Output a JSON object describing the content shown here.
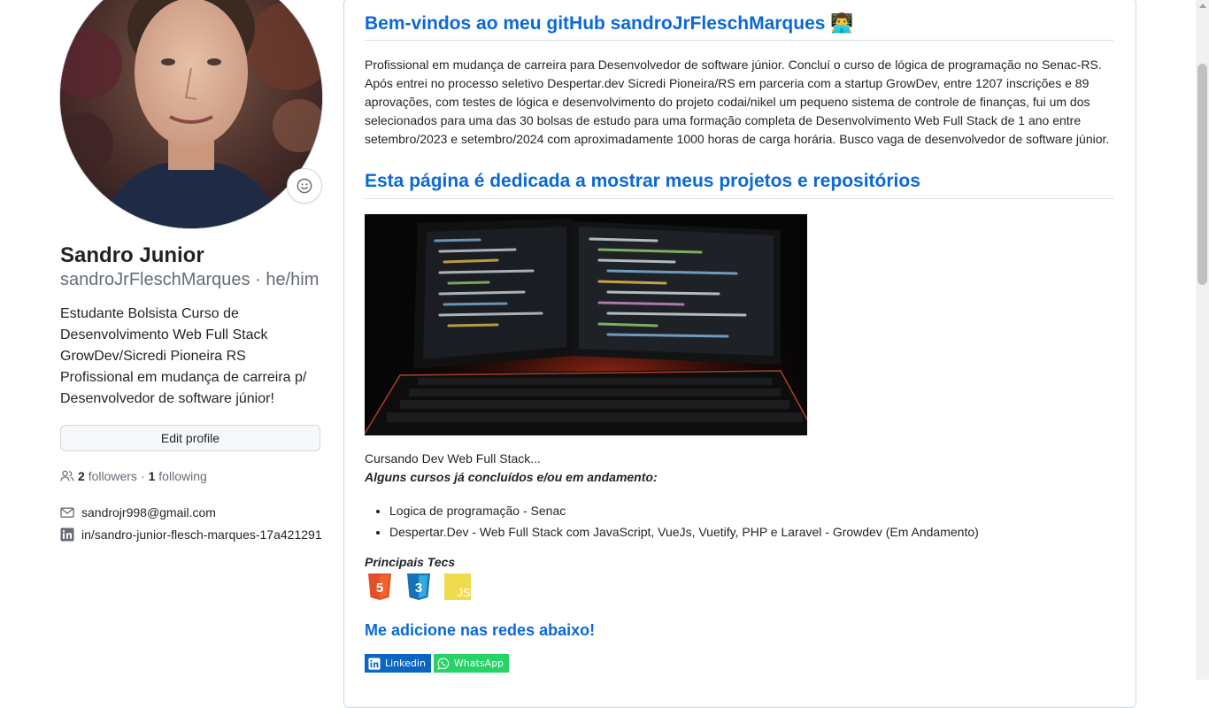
{
  "profile": {
    "name": "Sandro Junior",
    "login": "sandroJrFleschMarques",
    "pronouns": "he/him",
    "bio": "Estudante Bolsista Curso de Desenvolvimento Web Full Stack GrowDev/Sicredi Pioneira RS Profissional em mudança de carreira p/ Desenvolvedor de software júnior!",
    "edit_profile_label": "Edit profile",
    "followers_count": "2",
    "followers_label": "followers",
    "following_count": "1",
    "following_label": "following",
    "separator": "·",
    "email": "sandrojr998@gmail.com",
    "linkedin": "in/sandro-junior-flesch-marques-17a421291",
    "icons": {
      "emoji": "smiley-icon",
      "people": "people-icon",
      "mail": "mail-icon",
      "linkedin": "linkedin-icon"
    }
  },
  "readme": {
    "welcome_heading": "Bem-vindos ao meu gitHub sandroJrFleschMarques 👨‍💻",
    "intro": "Profissional em mudança de carreira para Desenvolvedor de software júnior. Concluí o curso de lógica de programação no Senac-RS. Após entrei no processo seletivo Despertar.dev Sicredi Pioneira/RS em parceria com a startup GrowDev, entre 1207 inscrições e 89 aprovações, com testes de lógica e desenvolvimento do projeto codai/nikel um pequeno sistema de controle de finanças, fui um dos selecionados para uma das 30 bolsas de estudo para uma formação completa de Desenvolvimento Web Full Stack de 1 ano entre setembro/2023 e setembro/2024 com aproximadamente 1000 horas de carga horária. Busco vaga de desenvolvedor de software júnior.",
    "dedicated_heading": "Esta página é dedicada a mostrar meus projetos e repositórios",
    "studying": "Cursando Dev Web Full Stack...",
    "courses_heading": "Alguns cursos já concluídos e/ou em andamento:",
    "courses": [
      "Logica de programação - Senac",
      "Despertar.Dev - Web Full Stack com JavaScript, VueJs, Vuetify, PHP e Laravel - Growdev (Em Andamento)"
    ],
    "tecs_heading": "Principais Tecs",
    "tecs": [
      {
        "icon": "html5-icon",
        "label": "5",
        "color": "#e34f26"
      },
      {
        "icon": "css3-icon",
        "label": "3",
        "color": "#1572b6"
      },
      {
        "icon": "javascript-icon",
        "label": "JS",
        "color": "#f0db4f"
      }
    ],
    "social_heading": "Me adicione nas redes abaixo!",
    "badges": [
      {
        "label": "Linkedin",
        "icon": "linkedin-icon",
        "color": "#0a66c2"
      },
      {
        "label": "WhatsApp",
        "icon": "whatsapp-icon",
        "color": "#25d366"
      }
    ]
  },
  "colors": {
    "link": "#0969da",
    "muted": "#656d76",
    "text": "#1f2328",
    "border": "#d0d7de"
  }
}
